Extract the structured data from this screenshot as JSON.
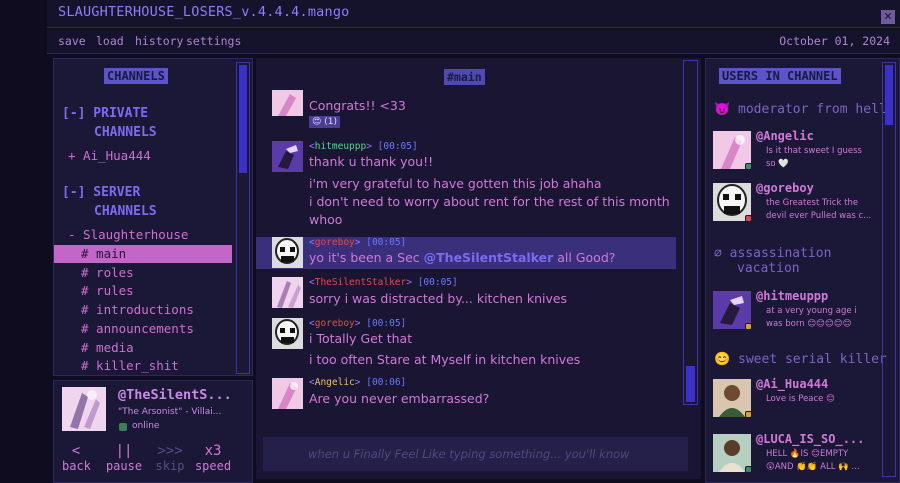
{
  "window": {
    "title": "SLAUGHTERHOUSE_LOSERS_v.4.4.4.mango",
    "close_icon": "close-icon"
  },
  "menu": {
    "items": [
      "save",
      "load",
      "history",
      "settings"
    ],
    "date": "October 01, 2024"
  },
  "channels": {
    "header": "CHANNELS",
    "private_label_1": "[-]  PRIVATE",
    "private_label_2": "CHANNELS",
    "private_items": [
      "+ Ai_Hua444"
    ],
    "server_label_1": "[-]  SERVER",
    "server_label_2": "CHANNELS",
    "server_name": "-  Slaughterhouse",
    "items": [
      "# main",
      "# roles",
      "# rules",
      "# introductions",
      "# announcements",
      "# media",
      "# killer_shit"
    ],
    "active_index": 0
  },
  "profile": {
    "name": "@TheSilentS...",
    "subtitle": "\"The Arsonist\" - Villai...",
    "status": "online"
  },
  "controls": [
    {
      "symbol": "<",
      "label": "back",
      "enabled": true
    },
    {
      "symbol": "||",
      "label": "pause",
      "enabled": true
    },
    {
      "symbol": ">>>",
      "label": "skip",
      "enabled": false
    },
    {
      "symbol": "x3",
      "label": "speed",
      "enabled": true
    }
  ],
  "chat": {
    "header": "#main",
    "messages": [
      {
        "user": "",
        "time": "",
        "lines": [
          "Congrats!! <33"
        ],
        "reaction": "😍 (1)"
      },
      {
        "user": "hitmeuppp",
        "time": "[00:05]",
        "lines": [
          "thank u thank you!!",
          "i'm very grateful to have gotten this job ahaha",
          "i don't need to worry about rent for the rest of this month",
          "whoo"
        ]
      },
      {
        "user": "goreboy",
        "time": "[00:05]",
        "text_before": "yo it's been a Sec ",
        "mention": "@TheSilentStalker",
        "text_after": " all Good?"
      },
      {
        "user": "TheSilentStalker",
        "time": "[00:05]",
        "lines": [
          "sorry i was distracted by... kitchen knives"
        ]
      },
      {
        "user": "goreboy",
        "time": "[00:05]",
        "lines": [
          "i Totally Get that",
          "i too often Stare at Myself in kitchen knives"
        ]
      },
      {
        "user": "Angelic",
        "time": "[00:06]",
        "lines": [
          "Are you never embarrassed?"
        ]
      }
    ],
    "input_placeholder": "when u Finally Feel Like typing something... you'll know"
  },
  "users": {
    "header": "USERS IN CHANNEL",
    "roles": [
      {
        "icon": "😈",
        "name": "moderator from hell"
      },
      {
        "icon": "∅",
        "name_1": "assassination",
        "name_2": "vacation"
      },
      {
        "icon": "😊",
        "name": "sweet serial killer"
      }
    ],
    "list": [
      {
        "name": "@Angelic",
        "bio_1": "Is it that sweet I guess",
        "bio_2": "so 🤍",
        "status_color": "#3a8f5a"
      },
      {
        "name": "@goreboy",
        "bio_1": "the Greatest Trick the",
        "bio_2": "devil ever Pulled was c...",
        "status_color": "#d84a4a"
      },
      {
        "name": "@hitmeuppp",
        "bio_1": "at a very young age i",
        "bio_2": "was born 😊😊😊😊😊",
        "status_color": "#e0a030"
      },
      {
        "name": "@Ai_Hua444",
        "bio_1": "Love is Peace 😊",
        "bio_2": "",
        "status_color": "#e0a030"
      },
      {
        "name": "@LUCA_IS_SO_...",
        "bio_1": "HELL 🔥IS 😊EMPTY",
        "bio_2": "😲AND 👏👏 ALL 🙌 ...",
        "status_color": "#3a8f5a"
      }
    ]
  }
}
